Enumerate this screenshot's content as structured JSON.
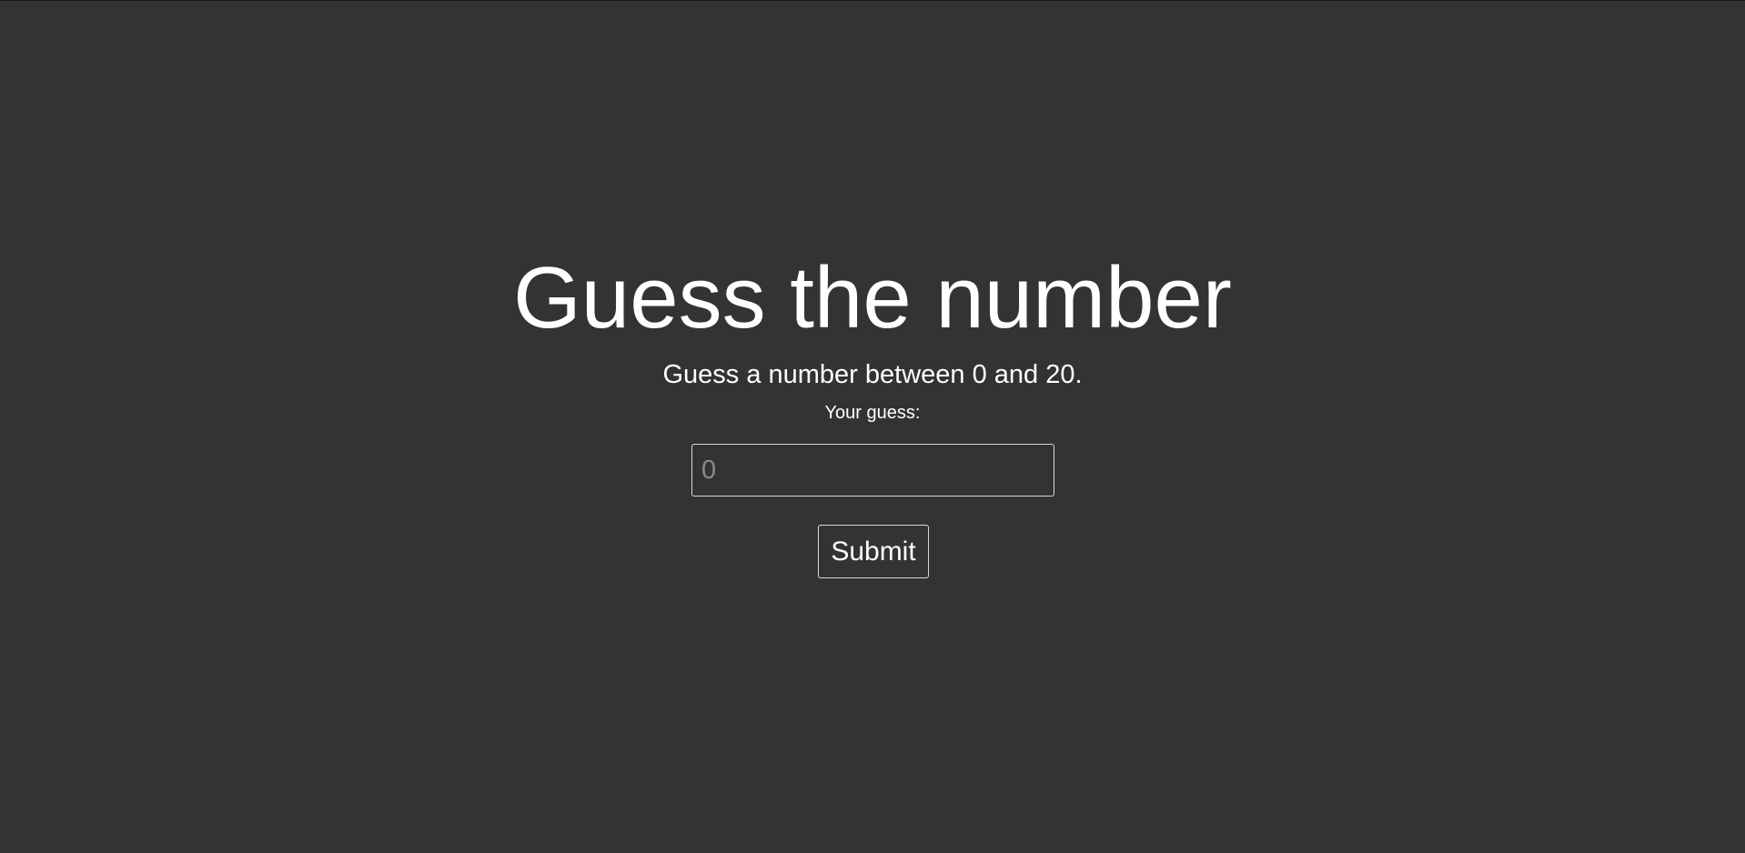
{
  "game": {
    "title": "Guess the number",
    "instructions": "Guess a number between 0 and 20.",
    "guess_label": "Your guess:",
    "guess_placeholder": "0",
    "guess_value": "",
    "submit_label": "Submit"
  },
  "colors": {
    "background": "#333333",
    "text": "#ffffff",
    "border": "#d9d9d9",
    "placeholder": "#8a8a8a"
  }
}
